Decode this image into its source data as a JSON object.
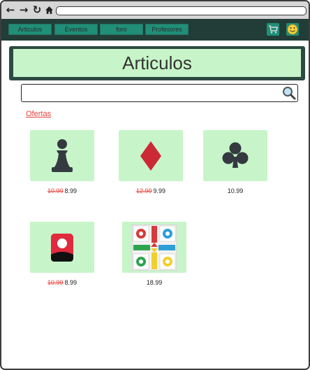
{
  "nav": {
    "tabs": [
      {
        "label": "Articulos"
      },
      {
        "label": "Eventos"
      },
      {
        "label": "foro"
      },
      {
        "label": "Profesores"
      }
    ]
  },
  "banner": {
    "title": "Articulos"
  },
  "search": {
    "placeholder": ""
  },
  "offers_link": "Ofertas",
  "products": [
    {
      "icon": "chess-pawn-icon",
      "old_price": "10.99",
      "price": "8.99"
    },
    {
      "icon": "diamond-icon",
      "old_price": "12.99",
      "price": "9.99"
    },
    {
      "icon": "club-icon",
      "old_price": "",
      "price": "10.99"
    },
    {
      "icon": "card-icon",
      "old_price": "10.99",
      "price": "8.99"
    },
    {
      "icon": "parchis-board-icon",
      "old_price": "",
      "price": "18.99"
    }
  ],
  "colors": {
    "appbar": "#223d37",
    "tab": "#1f8f78",
    "banner": "#c7f5c9",
    "accent": "#e8403a"
  }
}
